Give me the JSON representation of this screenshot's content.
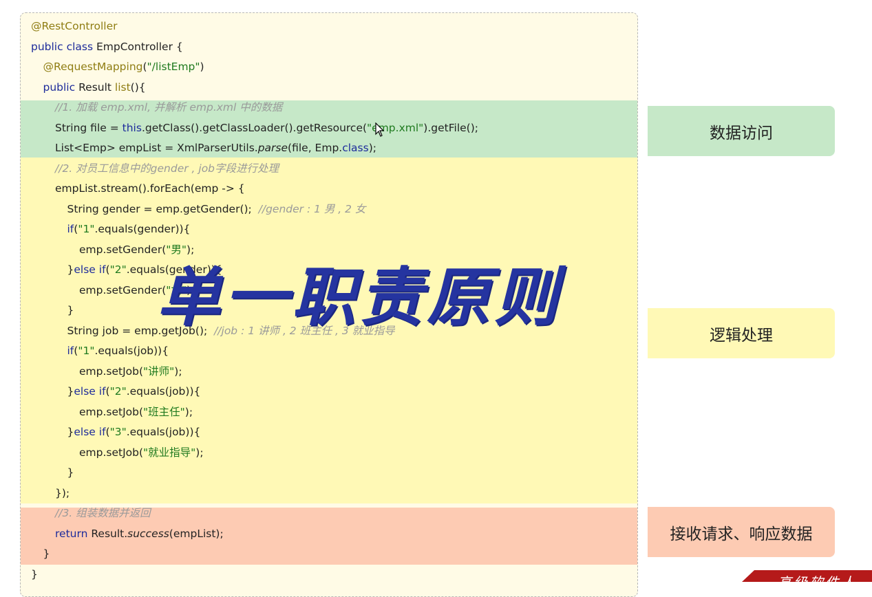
{
  "code_lines": [
    {
      "indent": 0,
      "tokens": [
        {
          "t": "@RestController",
          "c": "ann"
        }
      ]
    },
    {
      "indent": 0,
      "tokens": [
        {
          "t": "public class ",
          "c": "kw"
        },
        {
          "t": "EmpController {",
          "c": ""
        }
      ]
    },
    {
      "indent": 1,
      "tokens": [
        {
          "t": "@RequestMapping",
          "c": "ann"
        },
        {
          "t": "(",
          "c": ""
        },
        {
          "t": "\"/listEmp\"",
          "c": "str"
        },
        {
          "t": ")",
          "c": ""
        }
      ]
    },
    {
      "indent": 1,
      "tokens": [
        {
          "t": "public ",
          "c": "kw"
        },
        {
          "t": "Result ",
          "c": ""
        },
        {
          "t": "list",
          "c": "ann"
        },
        {
          "t": "(){",
          "c": ""
        }
      ]
    },
    {
      "indent": 2,
      "tokens": [
        {
          "t": "//1. 加载 emp.xml, 并解析 emp.xml 中的数据",
          "c": "cmt"
        }
      ]
    },
    {
      "indent": 2,
      "tokens": [
        {
          "t": "String file = ",
          "c": ""
        },
        {
          "t": "this",
          "c": "kw"
        },
        {
          "t": ".getClass().getClassLoader().getResource(",
          "c": ""
        },
        {
          "t": "\"emp.xml\"",
          "c": "str"
        },
        {
          "t": ").getFile();",
          "c": ""
        }
      ]
    },
    {
      "indent": 2,
      "tokens": [
        {
          "t": "List<Emp> empList = XmlParserUtils.",
          "c": ""
        },
        {
          "t": "parse",
          "c": "it"
        },
        {
          "t": "(file, Emp.",
          "c": ""
        },
        {
          "t": "class",
          "c": "kw"
        },
        {
          "t": ");",
          "c": ""
        }
      ]
    },
    {
      "indent": 2,
      "tokens": [
        {
          "t": "//2. 对员工信息中的gender , job字段进行处理",
          "c": "cmt"
        }
      ]
    },
    {
      "indent": 2,
      "tokens": [
        {
          "t": "empList.stream().forEach(emp -> {",
          "c": ""
        }
      ]
    },
    {
      "indent": 3,
      "tokens": [
        {
          "t": "String gender = emp.getGender();  ",
          "c": ""
        },
        {
          "t": "//gender : 1 男 , 2 女",
          "c": "cmt"
        }
      ]
    },
    {
      "indent": 3,
      "tokens": [
        {
          "t": "if",
          "c": "kw"
        },
        {
          "t": "(",
          "c": ""
        },
        {
          "t": "\"1\"",
          "c": "str"
        },
        {
          "t": ".equals(gender)){",
          "c": ""
        }
      ]
    },
    {
      "indent": 4,
      "tokens": [
        {
          "t": "emp.setGender(",
          "c": ""
        },
        {
          "t": "\"男\"",
          "c": "str"
        },
        {
          "t": ");",
          "c": ""
        }
      ]
    },
    {
      "indent": 3,
      "tokens": [
        {
          "t": "}",
          "c": ""
        },
        {
          "t": "else if",
          "c": "kw"
        },
        {
          "t": "(",
          "c": ""
        },
        {
          "t": "\"2\"",
          "c": "str"
        },
        {
          "t": ".equals(gender)){",
          "c": ""
        }
      ]
    },
    {
      "indent": 4,
      "tokens": [
        {
          "t": "emp.setGender(",
          "c": ""
        },
        {
          "t": "\"女\"",
          "c": "str"
        },
        {
          "t": ");",
          "c": ""
        }
      ]
    },
    {
      "indent": 3,
      "tokens": [
        {
          "t": "}",
          "c": ""
        }
      ]
    },
    {
      "indent": 3,
      "tokens": [
        {
          "t": "String job = emp.getJob();  ",
          "c": ""
        },
        {
          "t": "//job : 1 讲师 , 2 班主任 , 3 就业指导",
          "c": "cmt"
        }
      ]
    },
    {
      "indent": 3,
      "tokens": [
        {
          "t": "if",
          "c": "kw"
        },
        {
          "t": "(",
          "c": ""
        },
        {
          "t": "\"1\"",
          "c": "str"
        },
        {
          "t": ".equals(job)){",
          "c": ""
        }
      ]
    },
    {
      "indent": 4,
      "tokens": [
        {
          "t": "emp.setJob(",
          "c": ""
        },
        {
          "t": "\"讲师\"",
          "c": "str"
        },
        {
          "t": ");",
          "c": ""
        }
      ]
    },
    {
      "indent": 3,
      "tokens": [
        {
          "t": "}",
          "c": ""
        },
        {
          "t": "else if",
          "c": "kw"
        },
        {
          "t": "(",
          "c": ""
        },
        {
          "t": "\"2\"",
          "c": "str"
        },
        {
          "t": ".equals(job)){",
          "c": ""
        }
      ]
    },
    {
      "indent": 4,
      "tokens": [
        {
          "t": "emp.setJob(",
          "c": ""
        },
        {
          "t": "\"班主任\"",
          "c": "str"
        },
        {
          "t": ");",
          "c": ""
        }
      ]
    },
    {
      "indent": 3,
      "tokens": [
        {
          "t": "}",
          "c": ""
        },
        {
          "t": "else if",
          "c": "kw"
        },
        {
          "t": "(",
          "c": ""
        },
        {
          "t": "\"3\"",
          "c": "str"
        },
        {
          "t": ".equals(job)){",
          "c": ""
        }
      ]
    },
    {
      "indent": 4,
      "tokens": [
        {
          "t": "emp.setJob(",
          "c": ""
        },
        {
          "t": "\"就业指导\"",
          "c": "str"
        },
        {
          "t": ");",
          "c": ""
        }
      ]
    },
    {
      "indent": 3,
      "tokens": [
        {
          "t": "}",
          "c": ""
        }
      ]
    },
    {
      "indent": 2,
      "tokens": [
        {
          "t": "});",
          "c": ""
        }
      ]
    },
    {
      "indent": 2,
      "tokens": [
        {
          "t": "//3. 组装数据并返回",
          "c": "cmt"
        }
      ]
    },
    {
      "indent": 2,
      "tokens": [
        {
          "t": "return ",
          "c": "kw"
        },
        {
          "t": "Result.",
          "c": ""
        },
        {
          "t": "success",
          "c": "it"
        },
        {
          "t": "(empList);",
          "c": ""
        }
      ]
    },
    {
      "indent": 1,
      "tokens": [
        {
          "t": "}",
          "c": ""
        }
      ]
    },
    {
      "indent": 0,
      "tokens": [
        {
          "t": "}",
          "c": ""
        }
      ]
    }
  ],
  "labels": {
    "data_access": "数据访问",
    "logic": "逻辑处理",
    "request_response": "接收请求、响应数据"
  },
  "overlay_title": "单一职责原则",
  "corner_badge": "高级软件人",
  "colors": {
    "green_band": "#c6e8c8",
    "yellow_band": "#fff9b6",
    "red_band": "#fdcbb3",
    "panel_bg": "#fffbe6",
    "title_blue": "#2534a0"
  }
}
